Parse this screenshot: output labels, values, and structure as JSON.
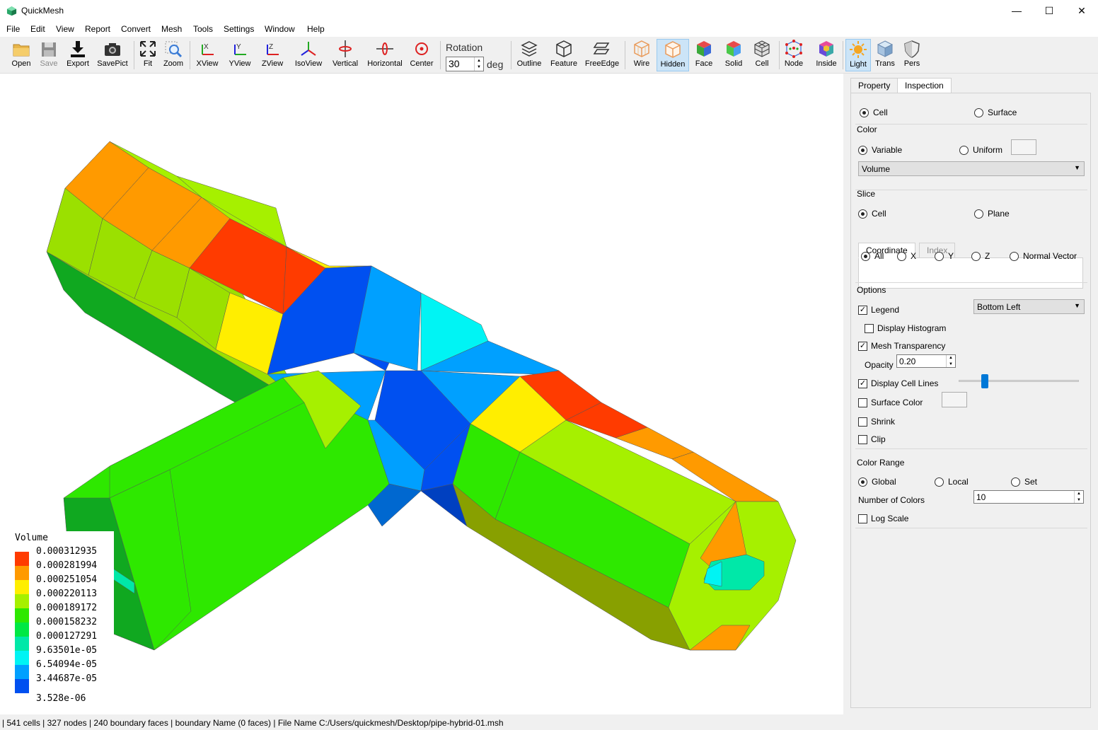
{
  "window": {
    "title": "QuickMesh",
    "minimize": "—",
    "maximize": "☐",
    "close": "✕"
  },
  "menu": [
    "File",
    "Edit",
    "View",
    "Report",
    "Convert",
    "Mesh",
    "Tools",
    "Settings",
    "Window",
    "Help"
  ],
  "toolbar": {
    "open": "Open",
    "save": "Save",
    "export": "Export",
    "savepict": "SavePict",
    "fit": "Fit",
    "zoom": "Zoom",
    "xview": "XView",
    "yview": "YView",
    "zview": "ZView",
    "isoview": "IsoView",
    "vertical": "Vertical",
    "horizontal": "Horizontal",
    "center": "Center",
    "rotation_label": "Rotation",
    "rotation_value": "30",
    "rotation_unit": "deg",
    "outline": "Outline",
    "feature": "Feature",
    "freeedge": "FreeEdge",
    "wire": "Wire",
    "hidden": "Hidden",
    "face": "Face",
    "solid": "Solid",
    "cell": "Cell",
    "node": "Node",
    "inside": "Inside",
    "light": "Light",
    "trans": "Trans",
    "pers": "Pers"
  },
  "legend": {
    "title": "Volume",
    "values": [
      "0.000312935",
      "0.000281994",
      "0.000251054",
      "0.000220113",
      "0.000189172",
      "0.000158232",
      "0.000127291",
      "9.63501e-05",
      "6.54094e-05",
      "3.44687e-05",
      "3.528e-06"
    ],
    "colors": [
      "#ff3b00",
      "#ff9a00",
      "#ffee00",
      "#a6f000",
      "#2ee800",
      "#00e844",
      "#00e8a8",
      "#00f4f4",
      "#00a0ff",
      "#0050f0"
    ]
  },
  "panel": {
    "tabs": [
      "Property",
      "Inspection"
    ],
    "target_cell": "Cell",
    "target_surface": "Surface",
    "color_title": "Color",
    "color_variable": "Variable",
    "color_uniform": "Uniform",
    "color_var_value": "Volume",
    "slice_title": "Slice",
    "slice_cell": "Cell",
    "slice_plane": "Plane",
    "subtabs": [
      "Coordinate",
      "Index"
    ],
    "coord_all": "All",
    "coord_x": "X",
    "coord_y": "Y",
    "coord_z": "Z",
    "coord_normal": "Normal Vector",
    "options_title": "Options",
    "legend_label": "Legend",
    "legend_position": "Bottom Left",
    "display_histogram": "Display Histogram",
    "mesh_transparency": "Mesh Transparency",
    "opacity_label": "Opacity",
    "opacity_value": "0.20",
    "opacity_fraction": 0.2,
    "display_cell_lines": "Display Cell Lines",
    "surface_color": "Surface Color",
    "shrink": "Shrink",
    "clip": "Clip",
    "range_title": "Color Range",
    "range_global": "Global",
    "range_local": "Local",
    "range_set": "Set",
    "num_colors_label": "Number of Colors",
    "num_colors_value": "10",
    "log_scale": "Log Scale"
  },
  "status": "| 541 cells | 327 nodes | 240 boundary faces |  boundary Name  (0 faces) | File Name C:/Users/quickmesh/Desktop/pipe-hybrid-01.msh"
}
